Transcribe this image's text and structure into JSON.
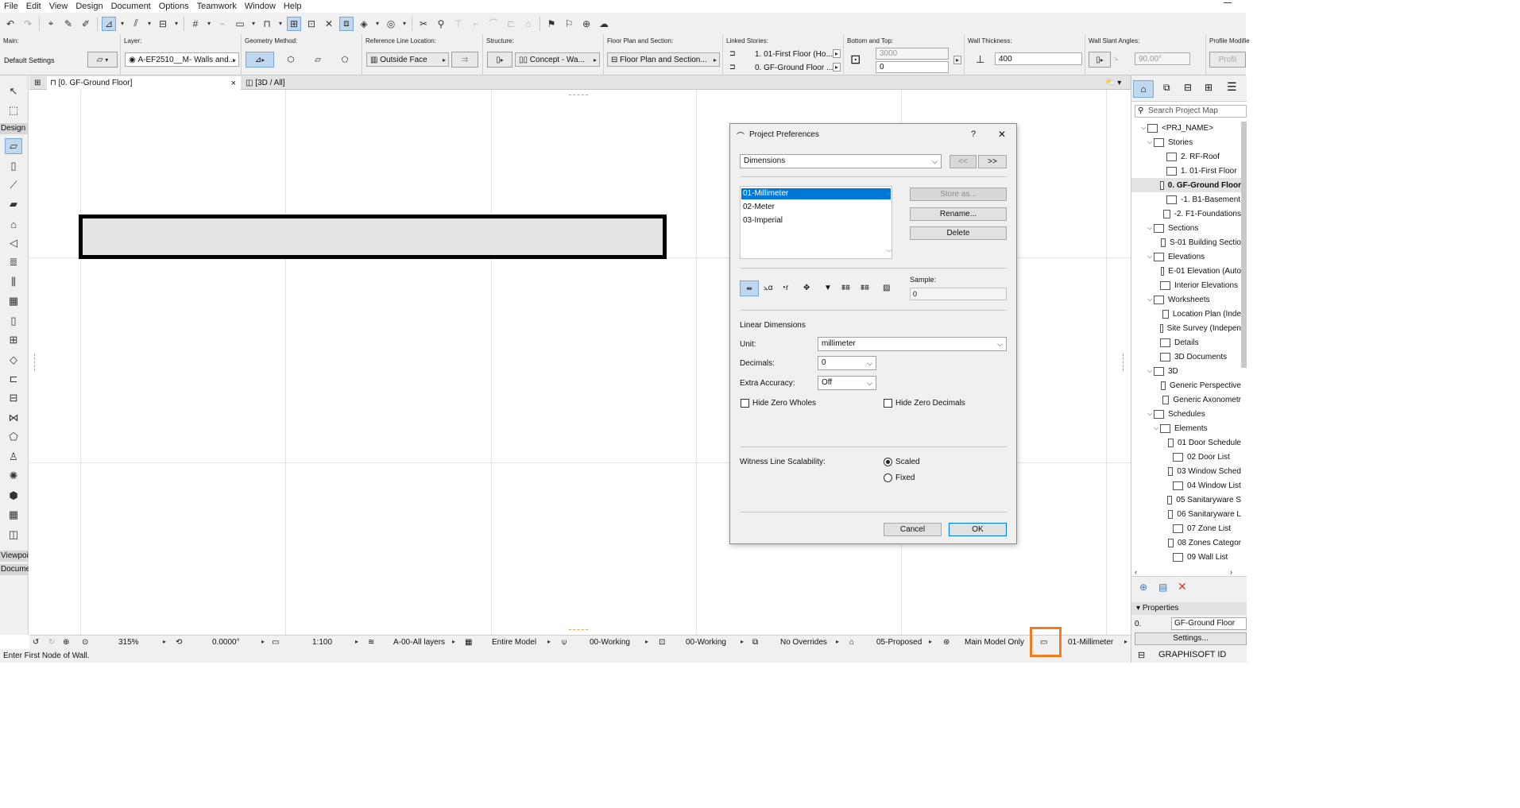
{
  "menu": [
    "File",
    "Edit",
    "View",
    "Design",
    "Document",
    "Options",
    "Teamwork",
    "Window",
    "Help"
  ],
  "infobox": {
    "main_label": "Main:",
    "main_value": "Default Settings",
    "layer_label": "Layer:",
    "layer_value": "A-EF2510__M- Walls and...",
    "geometry_label": "Geometry Method:",
    "refline_label": "Reference Line Location:",
    "refline_value": "Outside Face",
    "structure_label": "Structure:",
    "structure_value": "Concept - Wa...",
    "floorplan_label": "Floor Plan and Section:",
    "floorplan_value": "Floor Plan and Section...",
    "linked_label": "Linked Stories:",
    "linked_top": "1. 01-First Floor (Ho...",
    "linked_bottom": "0. GF-Ground Floor ...",
    "bottomtop_label": "Bottom and Top:",
    "top_value": "3000",
    "bottom_value": "0",
    "thickness_label": "Wall Thickness:",
    "thickness_value": "400",
    "slant_label": "Wall Slant Angles:",
    "slant_value": "90.00°",
    "profile_label": "Profile Modifie",
    "profile_btn": "Profil"
  },
  "toolbox": {
    "design_header": "Design",
    "viewpoint_header": "Viewpoi",
    "document_header": "Docume"
  },
  "tabs": {
    "floor_plan": "[0. GF-Ground Floor]",
    "close": "×",
    "view3d": "[3D / All]"
  },
  "navbar": {
    "zoom": "315%",
    "angle": "0.0000°",
    "scale": "1:100",
    "layer_combo": "A-00-All layers",
    "model_view": "Entire Model",
    "pen_set": "00-Working",
    "mvo": "00-Working",
    "graphic_override": "No Overrides",
    "renovation": "05-Proposed",
    "model_only": "Main Model Only",
    "dimension": "01-Millimeter"
  },
  "status": "Enter First Node of Wall.",
  "navigator": {
    "search_placeholder": "Search Project Map",
    "items": [
      {
        "label": "<PRJ_NAME>"
      },
      {
        "label": "Stories"
      },
      {
        "label": "2. RF-Roof"
      },
      {
        "label": "1. 01-First Floor"
      },
      {
        "label": "0. GF-Ground Floor"
      },
      {
        "label": "-1. B1-Basement"
      },
      {
        "label": "-2. F1-Foundations"
      },
      {
        "label": "Sections"
      },
      {
        "label": "S-01 Building Sectio"
      },
      {
        "label": "Elevations"
      },
      {
        "label": "E-01 Elevation (Auto"
      },
      {
        "label": "Interior Elevations"
      },
      {
        "label": "Worksheets"
      },
      {
        "label": "Location Plan (Inde"
      },
      {
        "label": "Site Survey (Indepen"
      },
      {
        "label": "Details"
      },
      {
        "label": "3D Documents"
      },
      {
        "label": "3D"
      },
      {
        "label": "Generic Perspective"
      },
      {
        "label": "Generic Axonometr"
      },
      {
        "label": "Schedules"
      },
      {
        "label": "Elements"
      },
      {
        "label": "01 Door Schedule"
      },
      {
        "label": "02 Door List"
      },
      {
        "label": "03 Window Sched"
      },
      {
        "label": "04 Window List"
      },
      {
        "label": "05 Sanitaryware S"
      },
      {
        "label": "06 Sanitaryware L"
      },
      {
        "label": "07 Zone List"
      },
      {
        "label": "08 Zones Categor"
      },
      {
        "label": "09 Wall List"
      }
    ],
    "properties_header": "Properties",
    "prop_id": "0.",
    "prop_value": "GF-Ground Floor",
    "settings_btn": "Settings...",
    "brand": "GRAPHISOFT ID"
  },
  "dialog": {
    "title": "Project Preferences",
    "help": "?",
    "close": "✕",
    "page_select": "Dimensions",
    "prev": "<<",
    "next": ">>",
    "standards": [
      "01-Millimeter",
      "02-Meter",
      "03-Imperial"
    ],
    "store_as": "Store as...",
    "rename": "Rename...",
    "delete": "Delete",
    "sample_label": "Sample:",
    "sample_value": "0",
    "section_linear": "Linear Dimensions",
    "unit_label": "Unit:",
    "unit_value": "millimeter",
    "decimals_label": "Decimals:",
    "decimals_value": "0",
    "extra_label": "Extra Accuracy:",
    "extra_value": "Off",
    "hide_zero_wholes": "Hide Zero Wholes",
    "hide_zero_decimals": "Hide Zero Decimals",
    "witness_label": "Witness Line Scalability:",
    "scaled": "Scaled",
    "fixed": "Fixed",
    "cancel": "Cancel",
    "ok": "OK"
  }
}
